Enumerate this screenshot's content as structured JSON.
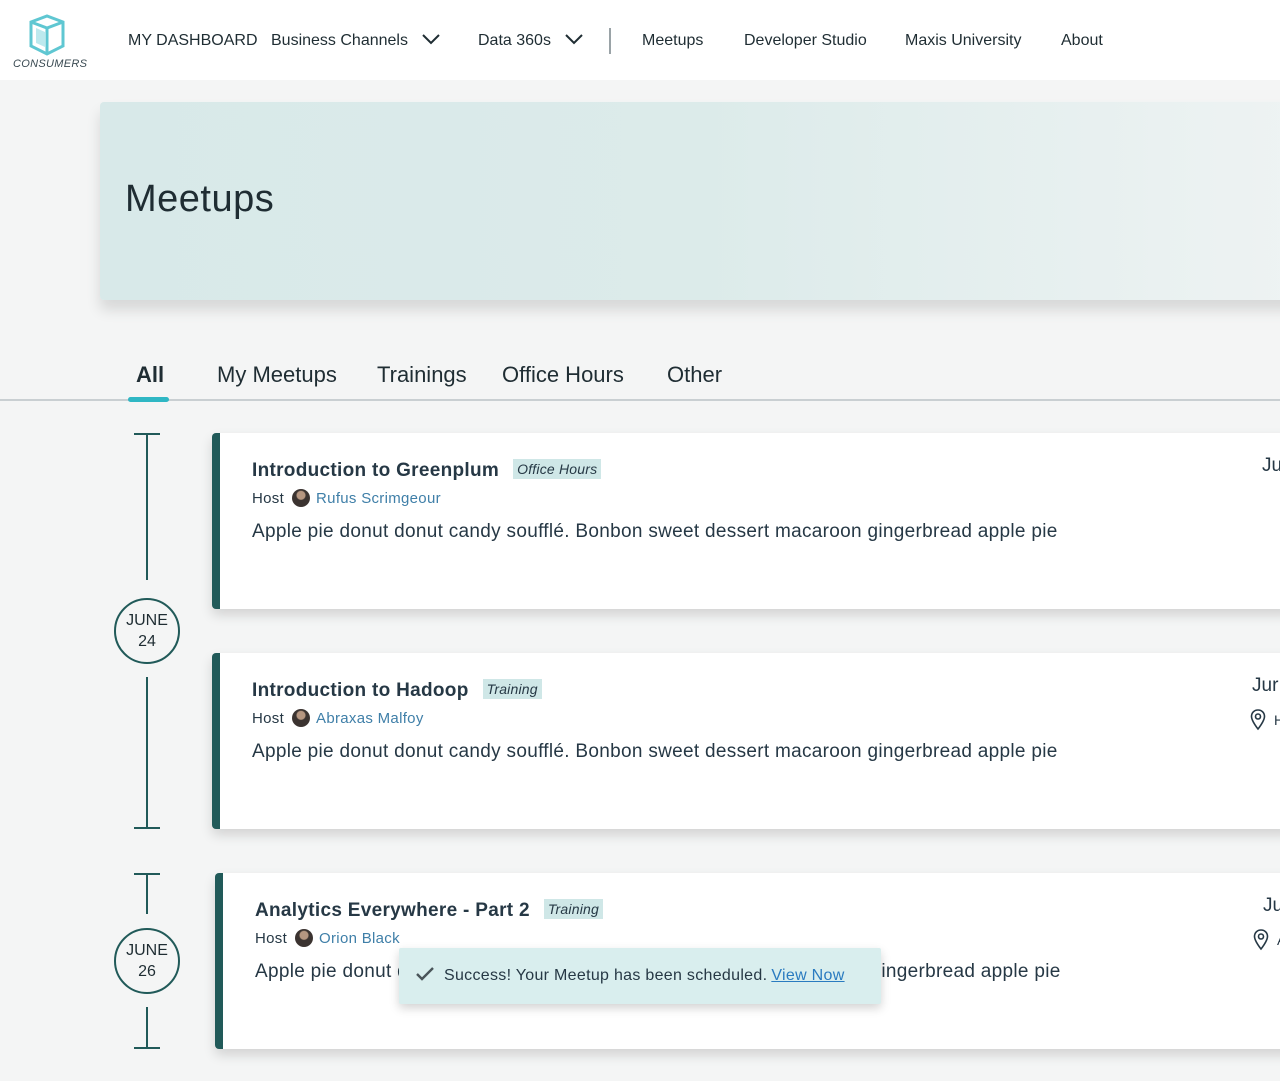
{
  "brand": {
    "logo_text": "CONSUMERS",
    "accent": "#2fb7c4",
    "primary": "#215a59"
  },
  "nav": {
    "items": [
      {
        "label": "MY DASHBOARD"
      },
      {
        "label": "Business Channels"
      },
      {
        "label": "Data 360s"
      },
      {
        "label": "Meetups"
      },
      {
        "label": "Developer Studio"
      },
      {
        "label": "Maxis University"
      },
      {
        "label": "About"
      }
    ]
  },
  "hero": {
    "title": "Meetups"
  },
  "tabs": [
    {
      "label": "All",
      "active": true
    },
    {
      "label": "My Meetups"
    },
    {
      "label": "Trainings"
    },
    {
      "label": "Office Hours"
    },
    {
      "label": "Other"
    }
  ],
  "timeline": {
    "dates": [
      {
        "month": "JUNE",
        "day": "24"
      },
      {
        "month": "JUNE",
        "day": "26"
      }
    ]
  },
  "meetups": [
    {
      "title": "Introduction to Greenplum",
      "type": "Office Hours",
      "host_label": "Host",
      "host": "Rufus Scrimgeour",
      "description": "Apple pie donut donut candy soufflé. Bonbon sweet dessert macaroon gingerbread apple pie",
      "date_partial": "Ju"
    },
    {
      "title": "Introduction to Hadoop",
      "type": "Training",
      "host_label": "Host",
      "host": "Abraxas Malfoy",
      "description": "Apple pie donut donut candy soufflé. Bonbon sweet dessert macaroon gingerbread apple pie",
      "date_partial": "Jur",
      "location_partial": "H"
    },
    {
      "title": "Analytics Everywhere - Part 2",
      "type": "Training",
      "host_label": "Host",
      "host": "Orion Black",
      "description": "Apple pie donut donut candy soufflé. Bonbon sweet dessert macaroon gingerbread apple pie",
      "date_partial": "Ju",
      "location_partial": "A"
    }
  ],
  "toast": {
    "message": "Success! Your Meetup has been scheduled.",
    "link": "View Now",
    "icon": "checkmark-icon"
  },
  "icons": {
    "logo": "cube-logo-icon",
    "dropdown": "chevron-down-icon",
    "location": "map-pin-icon",
    "avatar": "user-avatar"
  }
}
